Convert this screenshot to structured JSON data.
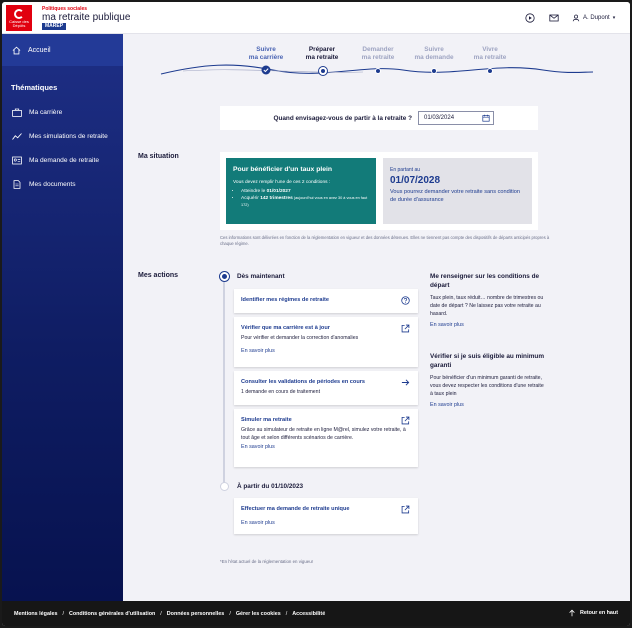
{
  "header": {
    "brand_top": "Politiques sociales",
    "logo_text": "Caisse des Dépôts",
    "brand_main": "ma retraite publique",
    "brand_sub": "MAREP",
    "play_icon": "play-circle-icon",
    "mail_icon": "mail-icon",
    "user_name": "A. Dupont"
  },
  "sidebar": {
    "home_label": "Accueil",
    "section_title": "Thématiques",
    "items": [
      {
        "label": "Ma carrière",
        "icon": "briefcase-icon"
      },
      {
        "label": "Mes simulations de retraite",
        "icon": "chart-line-icon"
      },
      {
        "label": "Ma demande de retraite",
        "icon": "id-card-icon"
      },
      {
        "label": "Mes documents",
        "icon": "document-icon"
      }
    ]
  },
  "stepper": {
    "steps": [
      {
        "line1": "Suivre",
        "line2": "ma carrière",
        "state": "done"
      },
      {
        "line1": "Préparer",
        "line2": "ma retraite",
        "state": "active"
      },
      {
        "line1": "Demander",
        "line2": "ma retraite",
        "state": "todo"
      },
      {
        "line1": "Suivre",
        "line2": "ma demande",
        "state": "todo"
      },
      {
        "line1": "Vivre",
        "line2": "ma retraite",
        "state": "todo"
      }
    ]
  },
  "question": {
    "label": "Quand envisagez-vous de partir à la retraite ?",
    "date_value": "01/03/2024"
  },
  "situation": {
    "title": "Ma situation",
    "teal_title": "Pour bénéficier d'un taux plein",
    "teal_intro": "Vous devez remplir l'une de ces 2 conditions :",
    "cond1_prefix": "Atteindre le ",
    "cond1_date": "01/01/2027",
    "cond2_prefix": "Acquérir ",
    "cond2_value": "142 trimestres",
    "cond2_suffix": " (aujourd'hui vous en avez 30 à vous en faut 172)",
    "grey_small": "En partant au",
    "grey_date": "01/07/2028",
    "grey_text": "Vous pourrez demander votre retraite sans condition de durée d'assurance",
    "footnote": "Ces informations sont délivrées en fonction de la réglementation en vigueur et des données détenues. Elles ne tiennent pas compte des dispositifs de départs anticipés propres à chaque régime."
  },
  "actions": {
    "title": "Mes actions",
    "head_now": "Dès maintenant",
    "head_later": "À partir du 01/10/2023",
    "cards": [
      {
        "title": "Identifier mes régimes de retraite",
        "desc": "",
        "link": "",
        "icon": "help-circle-icon"
      },
      {
        "title": "Vérifier que ma carrière est à jour",
        "desc": "Pour vérifier et demander la correction d'anomalies",
        "link": "En savoir plus",
        "icon": "external-link-icon"
      },
      {
        "title": "Consulter les validations de périodes en cours",
        "desc": "1 demande en cours de traitement",
        "link": "",
        "icon": "arrow-right-icon"
      },
      {
        "title": "Simuler ma retraite",
        "desc": "Grâce au simulateur de retraite en ligne M@rel, simulez votre retraite, à tout âge et selon différents scénarios de carrière.",
        "link": "En savoir plus",
        "icon": "external-link-icon"
      },
      {
        "title": "Effectuer ma demande de retraite unique",
        "desc": "",
        "link": "En savoir plus",
        "icon": "external-link-icon"
      }
    ]
  },
  "aside": {
    "block1_title": "Me renseigner sur les conditions de départ",
    "block1_desc": "Taux plein, taux réduit… nombre de trimestres ou date de départ ? Ne laissez pas votre retraite au hasard.",
    "block1_link": "En savoir plus",
    "block2_title": "Vérifier si je suis éligible au minimum garanti",
    "block2_desc": "Pour bénéficier d'un minimum garanti de retraite, vous devez respecter les conditions d'une retraite à taux plein",
    "block2_link": "En savoir plus"
  },
  "bottom_note": "*En l'état actuel de la réglementation en vigueur",
  "footer": {
    "links": [
      "Mentions légales",
      "Conditions générales d'utilisation",
      "Données personnelles",
      "Gérer les cookies",
      "Accessibilité"
    ],
    "back_to_top": "Retour en haut"
  },
  "colors": {
    "brand_red": "#e1000f",
    "navy": "#1d3b8f",
    "teal": "#127b79",
    "sidebar": "#0f1d63"
  }
}
